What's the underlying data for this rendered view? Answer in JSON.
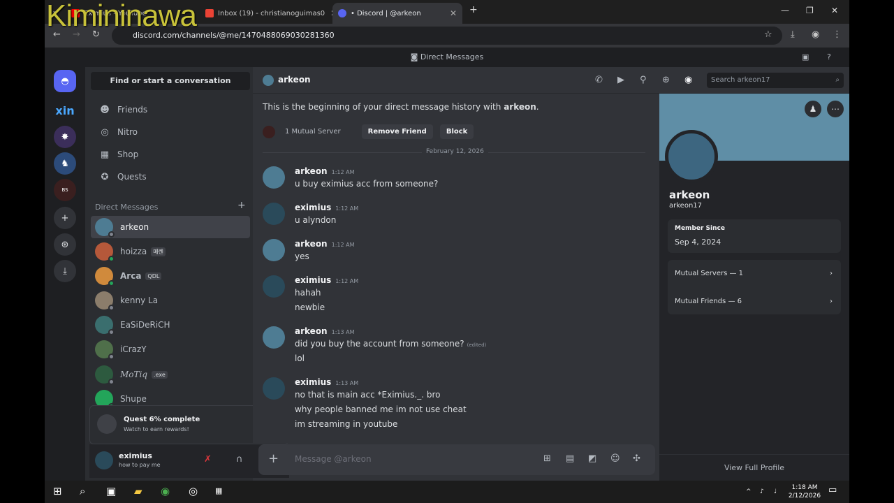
{
  "watermark": "Kimininawa",
  "browser": {
    "tabs": [
      {
        "title": "Eximius - YouTube",
        "fav": "#ff0000"
      },
      {
        "title": "Inbox (19) - christianoguimas0",
        "fav": "#ea4335"
      },
      {
        "title": "• Discord | @arkeon",
        "fav": "#5865f2"
      }
    ],
    "new_tab": "+",
    "url": "discord.com/channels/@me/1470488069030281360"
  },
  "discord": {
    "title": "Direct Messages",
    "find_conversation": "Find or start a conversation",
    "nav": [
      {
        "label": "Friends",
        "icon": "friends-icon",
        "glyph": "☻"
      },
      {
        "label": "Nitro",
        "icon": "nitro-icon",
        "glyph": "◎"
      },
      {
        "label": "Shop",
        "icon": "shop-icon",
        "glyph": "▦"
      },
      {
        "label": "Quests",
        "icon": "quests-icon",
        "glyph": "✪"
      }
    ],
    "dm_header": "Direct Messages",
    "dm_add": "+",
    "dms": [
      {
        "name": "arkeon",
        "tag": "",
        "online": false,
        "color": "#4e7c93"
      },
      {
        "name": "hoizza",
        "tag": "메렌",
        "online": true,
        "color": "#b5583a"
      },
      {
        "name": "Arca",
        "tag": "QDL",
        "online": true,
        "color": "#d08a3c"
      },
      {
        "name": "kenny La",
        "tag": "",
        "online": false,
        "color": "#8b7d6b"
      },
      {
        "name": "EaSiDeRiCH",
        "tag": "",
        "online": false,
        "color": "#3a6e6e"
      },
      {
        "name": "iCrazY",
        "tag": "",
        "online": false,
        "color": "#4f6f4a"
      },
      {
        "name": "MoTiq",
        "tag": ".exe",
        "online": false,
        "color": "#2d5a3f"
      },
      {
        "name": "Shupe",
        "tag": "",
        "online": true,
        "color": "#23a55a"
      }
    ],
    "quest": {
      "title": "Quest 6% complete",
      "subtitle": "Watch to earn rewards!"
    },
    "user": {
      "name": "eximius",
      "status": "how to pay me"
    },
    "chat": {
      "recipient": "arkeon",
      "search_placeholder": "Search arkeon17",
      "beginning_prefix": "This is the beginning of your direct message history with ",
      "beginning_name": "arkeon",
      "beginning_suffix": ".",
      "mutual_server": "1 Mutual Server",
      "remove_friend": "Remove Friend",
      "block": "Block",
      "date": "February 12, 2026",
      "messages": [
        {
          "author": "arkeon",
          "time": "1:12 AM",
          "lines": [
            "u buy eximius acc from someone?"
          ]
        },
        {
          "author": "eximius",
          "time": "1:12 AM",
          "lines": [
            "u alyndon"
          ]
        },
        {
          "author": "arkeon",
          "time": "1:12 AM",
          "lines": [
            "yes"
          ]
        },
        {
          "author": "eximius",
          "time": "1:12 AM",
          "lines": [
            "hahah",
            "newbie"
          ]
        },
        {
          "author": "arkeon",
          "time": "1:13 AM",
          "lines": [
            "did you buy the account from someone?",
            "lol"
          ],
          "edited": "(edited)"
        },
        {
          "author": "eximius",
          "time": "1:13 AM",
          "lines": [
            "no that is main acc *Eximius._. bro",
            "why people banned me im not use cheat",
            "im streaming in youtube"
          ]
        }
      ],
      "input_placeholder": "Message @arkeon"
    },
    "profile": {
      "display_name": "arkeon",
      "username": "arkeon17",
      "member_since_label": "Member Since",
      "member_since": "Sep 4, 2024",
      "mutual_servers": "Mutual Servers — 1",
      "mutual_friends": "Mutual Friends — 6",
      "view_full": "View Full Profile"
    }
  },
  "taskbar": {
    "time": "1:18 AM",
    "date": "2/12/2026"
  }
}
